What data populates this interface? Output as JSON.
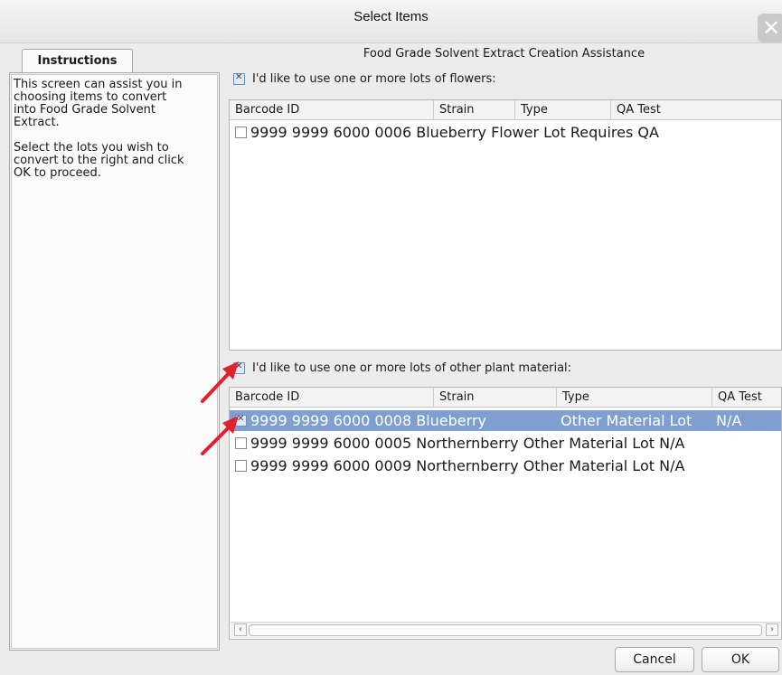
{
  "window": {
    "title": "Select Items",
    "close_icon": "close-icon"
  },
  "instructions": {
    "tab_label": "Instructions",
    "paragraph_1": "This screen can assist you in\nchoosing items to convert\ninto Food Grade Solvent\nExtract.",
    "paragraph_2": "Select the lots you wish to\nconvert to the right and click\nOK to proceed."
  },
  "main": {
    "heading": "Food Grade Solvent Extract Creation Assistance",
    "flowers_option": {
      "label": "I'd like to use one or more lots of flowers:",
      "checked": true
    },
    "flowers_table": {
      "columns": [
        "Barcode ID",
        "Strain",
        "Type",
        "QA Test"
      ],
      "rows": [
        {
          "barcode": "9999 9999 6000 0006",
          "strain": "Blueberry",
          "type": "Flower Lot",
          "qa": "Requires QA",
          "checked": false,
          "selected": false
        }
      ]
    },
    "other_option": {
      "label": "I'd like to use one or more lots of other plant material:",
      "checked": true
    },
    "other_table": {
      "columns": [
        "Barcode ID",
        "Strain",
        "Type",
        "QA Test"
      ],
      "rows": [
        {
          "barcode": "9999 9999 6000 0008",
          "strain": "Blueberry",
          "type": "Other Material Lot",
          "qa": "N/A",
          "checked": true,
          "selected": true
        },
        {
          "barcode": "9999 9999 6000 0005",
          "strain": "Northernberry",
          "type": "Other Material Lot",
          "qa": "N/A",
          "checked": false,
          "selected": false
        },
        {
          "barcode": "9999 9999 6000 0009",
          "strain": "Northernberry",
          "type": "Other Material Lot",
          "qa": "N/A",
          "checked": false,
          "selected": false
        }
      ]
    }
  },
  "buttons": {
    "cancel": "Cancel",
    "ok": "OK"
  },
  "colors": {
    "selection": "#7f9fd0",
    "annotation_arrow": "#e0212f"
  }
}
